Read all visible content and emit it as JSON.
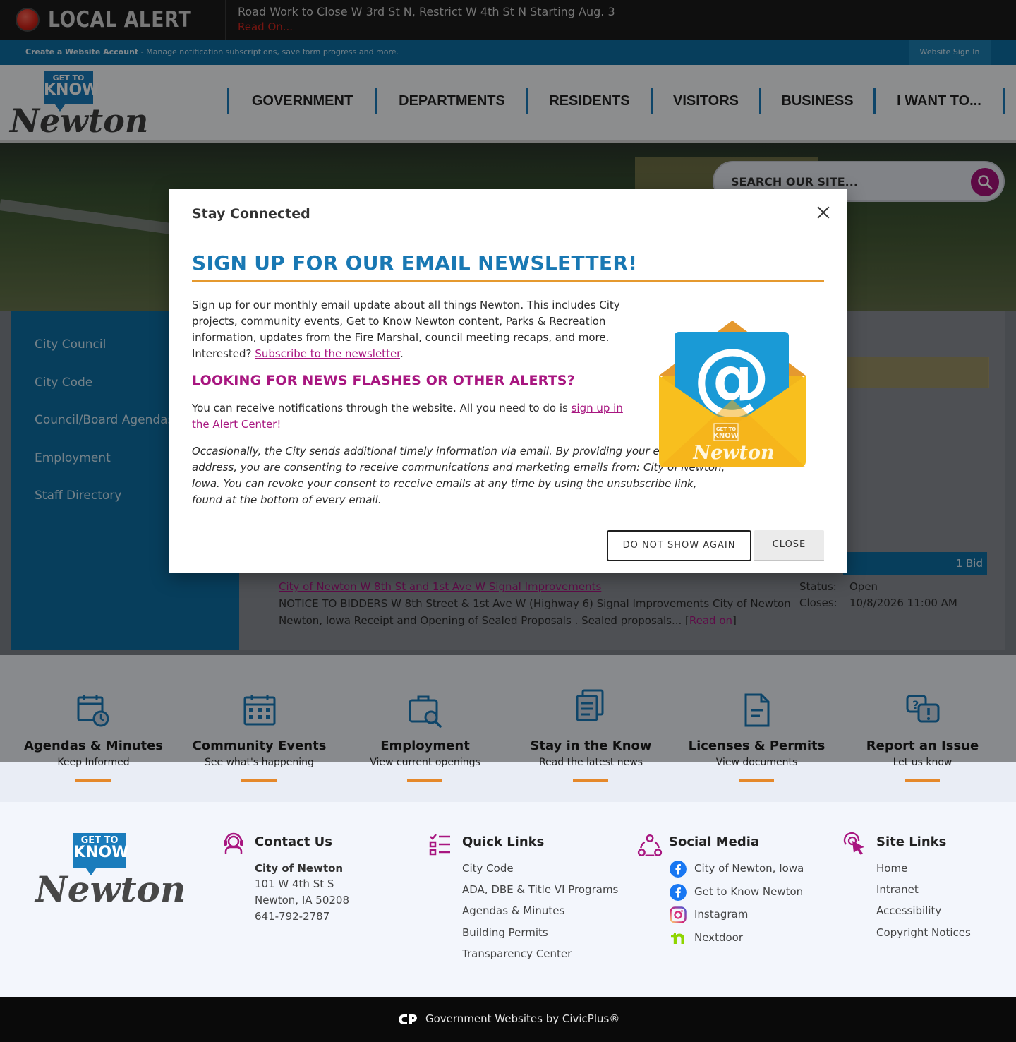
{
  "alert": {
    "title": "LOCAL ALERT",
    "message": "Road Work to Close W 3rd St N, Restrict W 4th St N Starting Aug. 3",
    "read_on": "Read On..."
  },
  "account_bar": {
    "create_label": "Create a Website Account",
    "create_desc": " - Manage notification subscriptions, save form progress and more.",
    "signin_label": "Website Sign In"
  },
  "logo": {
    "line1": "GET TO",
    "line2": "KNOW",
    "word": "Newton"
  },
  "nav": [
    "GOVERNMENT",
    "DEPARTMENTS",
    "RESIDENTS",
    "VISITORS",
    "BUSINESS",
    "I WANT TO..."
  ],
  "search": {
    "placeholder": "SEARCH OUR SITE..."
  },
  "sidebar": {
    "items": [
      "City Council",
      "City Code",
      "Council/Board Agendas",
      "Employment",
      "Staff Directory"
    ]
  },
  "bids": {
    "count": "1 Bid",
    "title": "City of Newton W 8th St and 1st Ave W Signal Improvements",
    "description": "NOTICE TO BIDDERS W 8th Street & 1st Ave W (Highway 6) Signal Improvements City of Newton Newton, Iowa Receipt and Opening of Sealed Proposals . Sealed proposals... ",
    "read_on": "Read on",
    "status_label": "Status:",
    "status_value": "Open",
    "closes_label": "Closes:",
    "closes_value": "10/8/2026 11:00 AM"
  },
  "modal": {
    "title": "Stay Connected",
    "heading": "SIGN UP FOR OUR EMAIL NEWSLETTER!",
    "intro": "Sign up for our monthly email update about all things Newton. This includes City projects, community events, Get to Know Newton content, Parks & Recreation information, updates from the Fire Marshal, council meeting recaps, and more. Interested? ",
    "subscribe_link": "Subscribe to the newsletter",
    "alerts_heading": "LOOKING FOR NEWS FLASHES OR OTHER ALERTS?",
    "alerts_text": "You can receive notifications through the website. All you need to do is ",
    "alerts_link": "sign up in the Alert Center!",
    "consent": "Occasionally, the City sends additional timely information via email. By providing your email address, you are consenting to receive communications and marketing emails from: City of Newton, Iowa. You can revoke your consent to receive emails at any time by using the unsubscribe link, found at the bottom of every email.",
    "btn_do_not_show": "DO NOT SHOW AGAIN",
    "btn_close": "CLOSE",
    "envelope_logo_line1": "GET TO",
    "envelope_logo_line2": "KNOW",
    "envelope_logo_word": "Newton"
  },
  "tiles": [
    {
      "title": "Agendas & Minutes",
      "subtitle": "Keep Informed",
      "icon": "calendar-clock-icon"
    },
    {
      "title": "Community Events",
      "subtitle": "See what's happening",
      "icon": "calendar-icon"
    },
    {
      "title": "Employment",
      "subtitle": "View current openings",
      "icon": "job-search-icon"
    },
    {
      "title": "Stay in the Know",
      "subtitle": "Read the latest news",
      "icon": "news-icon"
    },
    {
      "title": "Licenses & Permits",
      "subtitle": "View documents",
      "icon": "document-icon"
    },
    {
      "title": "Report an Issue",
      "subtitle": "Let us know",
      "icon": "report-issue-icon"
    }
  ],
  "footer": {
    "contact": {
      "title": "Contact Us",
      "org": "City of Newton",
      "address1": "101 W 4th St S",
      "address2": "Newton, IA 50208",
      "phone": "641-792-2787"
    },
    "quick_links": {
      "title": "Quick Links",
      "items": [
        "City Code",
        "ADA, DBE & Title VI Programs",
        "Agendas & Minutes",
        "Building Permits",
        "Transparency Center"
      ]
    },
    "social": {
      "title": "Social Media",
      "items": [
        {
          "label": "City of Newton, Iowa",
          "icon": "facebook-icon"
        },
        {
          "label": "Get to Know Newton",
          "icon": "facebook-icon"
        },
        {
          "label": "Instagram",
          "icon": "instagram-icon"
        },
        {
          "label": "Nextdoor",
          "icon": "nextdoor-icon"
        }
      ]
    },
    "site_links": {
      "title": "Site Links",
      "items": [
        "Home",
        "Intranet",
        "Accessibility",
        "Copyright Notices"
      ]
    },
    "credit": "Government Websites by CivicPlus®"
  },
  "colors": {
    "brand_blue": "#0d6fa4",
    "accent_magenta": "#a81680",
    "accent_orange": "#e5992f",
    "heading_blue": "#1978b3"
  }
}
